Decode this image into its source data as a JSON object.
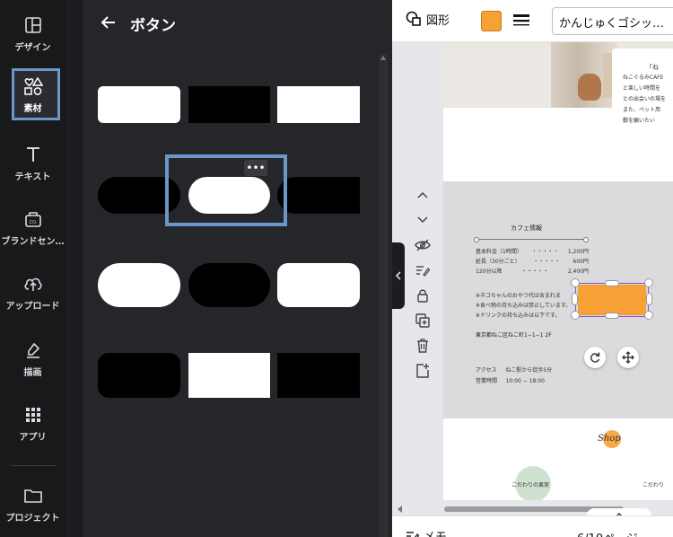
{
  "rail": {
    "items": [
      {
        "label": "デザイン",
        "icon": "layout-icon"
      },
      {
        "label": "素材",
        "icon": "elements-icon"
      },
      {
        "label": "テキスト",
        "icon": "text-icon"
      },
      {
        "label": "ブランドセン…",
        "icon": "brand-icon"
      },
      {
        "label": "アップロード",
        "icon": "upload-icon"
      },
      {
        "label": "描画",
        "icon": "draw-icon"
      },
      {
        "label": "アプリ",
        "icon": "apps-icon"
      },
      {
        "label": "プロジェクト",
        "icon": "folder-icon"
      }
    ],
    "active": "素材",
    "accent": "#6b96c9"
  },
  "panel": {
    "title": "ボタン",
    "more_glyph": "•••"
  },
  "toolbar": {
    "shape_label": "図形",
    "fill_color": "#f7a035",
    "font_name": "かんじゅくゴシッ…"
  },
  "page": {
    "intro_title": "「ね",
    "intro_lines": [
      "ねこぐるみCAFE",
      "と楽しい時間を",
      "との出会いの場を",
      "また、ペット用",
      "敷を願いたい"
    ],
    "cafe_title": "カフェ情報",
    "prices": [
      {
        "name": "基本料金（1時間）",
        "price": "1,200円"
      },
      {
        "name": "延長（30分ごと）",
        "price": "600円"
      },
      {
        "name": "120分以降",
        "price": "2,400円"
      }
    ],
    "price_dots": "・・・・・",
    "notes": [
      "※ネコちゃんのおやつ代は含まれま",
      "※食べ物の持ち込みは禁止しています。",
      "※ドリンクの持ち込みは以下です。"
    ],
    "address": "東京都ねこ区ねこ町1−1−1 2F",
    "access_label": "アクセス",
    "access_value": "ねこ駅から徒歩5分",
    "hours_label": "営業時間",
    "hours_value": "10:00 − 18:00",
    "shop_title": "Shop",
    "product1": "こだわりの果実",
    "product2": "こだわり"
  },
  "bottom": {
    "memo": "メモ",
    "pages": "6/10ページ"
  }
}
